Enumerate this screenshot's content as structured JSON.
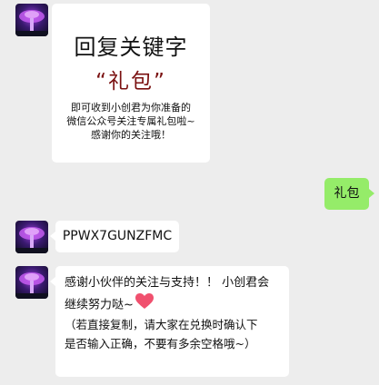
{
  "promo_card": {
    "title": "回复关键字",
    "keyword": "“礼包”",
    "desc_line1": "即可收到小创君为你准备的",
    "desc_line2": "微信公众号关注专属礼包啦~",
    "desc_line3": "感谢你的关注哦！"
  },
  "user_reply": "礼包",
  "code_message": "PPWX7GUNZFMC",
  "thanks_message": {
    "line1": "感谢小伙伴的关注与支持！！ 小创君会",
    "line2": "继续努力哒~",
    "note1": "（若直接复制，请大家在兑换时确认下",
    "note2": "是否输入正确，不要有多余空格哦~）"
  },
  "icons": {
    "heart": "heart-icon",
    "avatar": "avatar"
  }
}
